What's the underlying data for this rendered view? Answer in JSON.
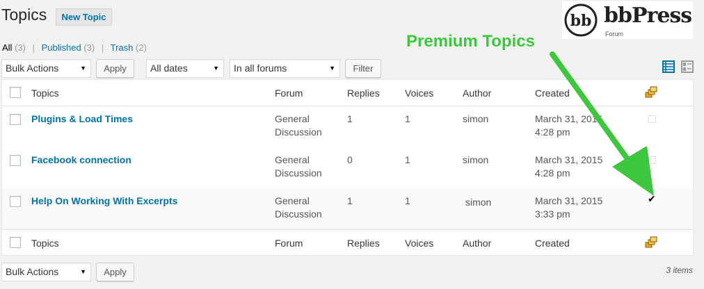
{
  "header": {
    "title": "Topics",
    "new_topic_label": "New Topic"
  },
  "filters": {
    "all_label": "All",
    "all_count": "(3)",
    "published_label": "Published",
    "published_count": "(3)",
    "trash_label": "Trash",
    "trash_count": "(2)",
    "separator": "|"
  },
  "toolbar_top": {
    "bulk_actions": "Bulk Actions",
    "apply": "Apply",
    "dates": "All dates",
    "forums": "In all forums",
    "filter": "Filter"
  },
  "table": {
    "columns": [
      "Topics",
      "Forum",
      "Replies",
      "Voices",
      "Author",
      "Created"
    ],
    "rows": [
      {
        "title": "Plugins & Load Times",
        "forum_line1": "General",
        "forum_line2": "Discussion",
        "replies": "1",
        "voices": "1",
        "author": "simon",
        "created_line1": "March 31, 2015",
        "created_line2": "4:28 pm",
        "premium": false
      },
      {
        "title": "Facebook connection",
        "forum_line1": "General",
        "forum_line2": "Discussion",
        "replies": "0",
        "voices": "1",
        "author": "simon",
        "created_line1": "March 31, 2015",
        "created_line2": "4:28 pm",
        "premium": false
      },
      {
        "title": "Help On Working With Excerpts",
        "forum_line1": "General",
        "forum_line2": "Discussion",
        "replies": "1",
        "voices": "1",
        "author": "simon",
        "created_line1": "March 31, 2015",
        "created_line2": "3:33 pm",
        "premium": true
      }
    ],
    "premium_check": "✔"
  },
  "toolbar_bottom": {
    "bulk_actions": "Bulk Actions",
    "apply": "Apply",
    "items_count": "3 items"
  },
  "annotation": {
    "label": "Premium Topics",
    "color": "#3fc63f"
  },
  "logo": {
    "text": "bbPress",
    "sub": "Forum",
    "mark": "bb"
  },
  "colors": {
    "link": "#0073aa",
    "background": "#f1f1f1"
  }
}
